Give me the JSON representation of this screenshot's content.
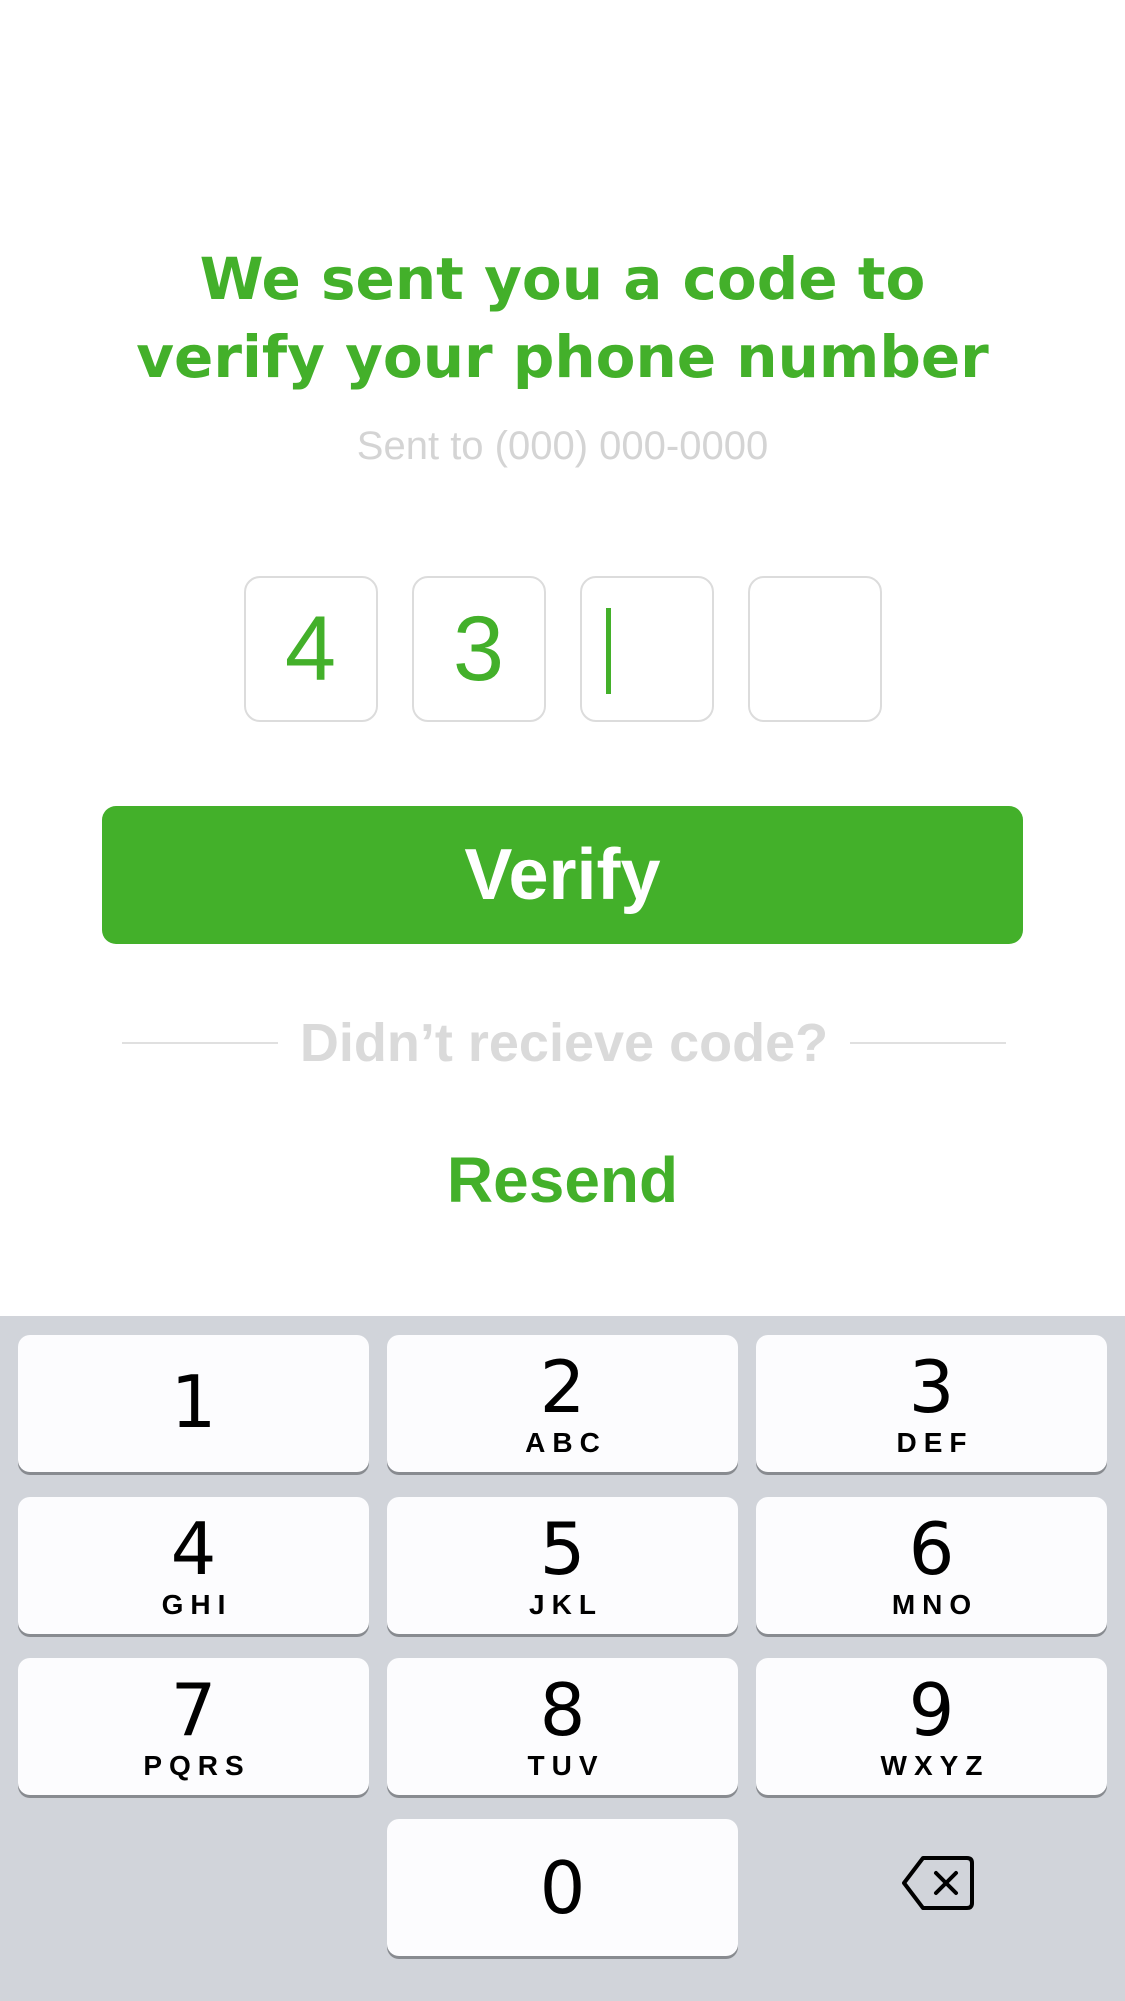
{
  "header": {
    "title_line1": "We sent you a code to",
    "title_line2": "verify your phone number",
    "subtitle": "Sent to (000) 000-0000"
  },
  "code": {
    "digits": [
      "4",
      "3",
      "",
      ""
    ],
    "active_index": 2
  },
  "verify_button": {
    "label": "Verify"
  },
  "resend_section": {
    "prompt": "Didn’t recieve code?",
    "resend_label": "Resend"
  },
  "keypad": {
    "keys": [
      {
        "num": "1",
        "letters": ""
      },
      {
        "num": "2",
        "letters": "ABC"
      },
      {
        "num": "3",
        "letters": "DEF"
      },
      {
        "num": "4",
        "letters": "GHI"
      },
      {
        "num": "5",
        "letters": "JKL"
      },
      {
        "num": "6",
        "letters": "MNO"
      },
      {
        "num": "7",
        "letters": "PQRS"
      },
      {
        "num": "8",
        "letters": "TUV"
      },
      {
        "num": "9",
        "letters": "WXYZ"
      },
      {
        "num": "0",
        "letters": ""
      }
    ],
    "backspace_icon": "backspace-icon"
  },
  "colors": {
    "accent": "#43b02a",
    "muted_text": "#d4d4d4",
    "keypad_bg": "#d1d4da",
    "key_bg": "#fcfcfe"
  }
}
